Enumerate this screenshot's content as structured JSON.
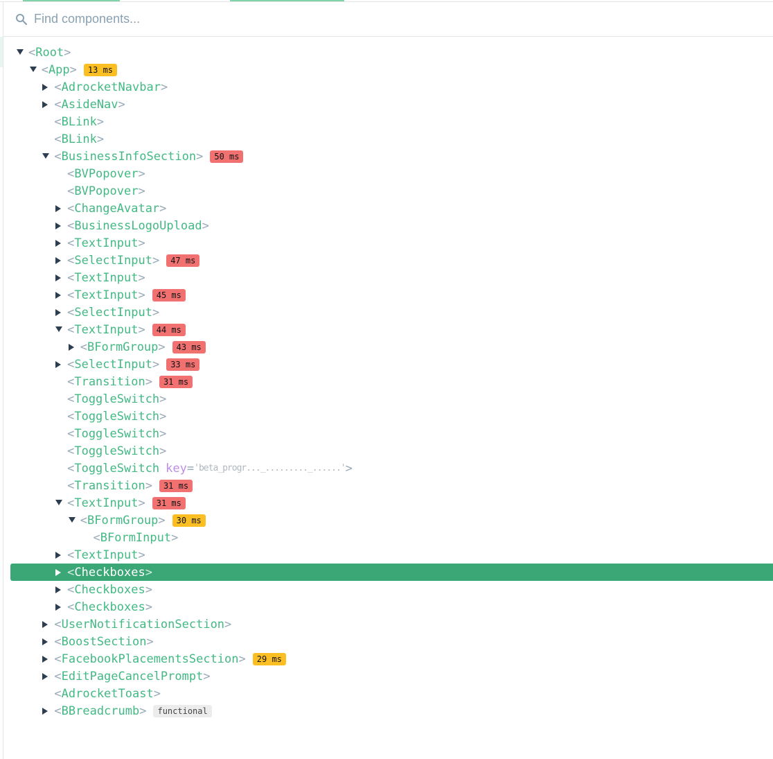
{
  "search": {
    "placeholder": "Find components...",
    "value": "",
    "icon": "search-icon"
  },
  "colors": {
    "accent": "#42b983",
    "selected_bg": "#3ba776",
    "badge_warn": "#fbbf24",
    "badge_slow": "#f17171",
    "badge_functional": "#ececec",
    "attr_key": "#c08be6",
    "bracket": "#97a8b6"
  },
  "tree": [
    {
      "depth": 0,
      "name": "Root",
      "arrow": "expanded"
    },
    {
      "depth": 1,
      "name": "App",
      "arrow": "expanded",
      "badge": "13 ms",
      "badge_type": "warn"
    },
    {
      "depth": 2,
      "name": "AdrocketNavbar",
      "arrow": "collapsed"
    },
    {
      "depth": 2,
      "name": "AsideNav",
      "arrow": "collapsed"
    },
    {
      "depth": 2,
      "name": "BLink",
      "arrow": "none"
    },
    {
      "depth": 2,
      "name": "BLink",
      "arrow": "none"
    },
    {
      "depth": 2,
      "name": "BusinessInfoSection",
      "arrow": "expanded",
      "badge": "50 ms",
      "badge_type": "slow"
    },
    {
      "depth": 3,
      "name": "BVPopover",
      "arrow": "none"
    },
    {
      "depth": 3,
      "name": "BVPopover",
      "arrow": "none"
    },
    {
      "depth": 3,
      "name": "ChangeAvatar",
      "arrow": "collapsed"
    },
    {
      "depth": 3,
      "name": "BusinessLogoUpload",
      "arrow": "collapsed"
    },
    {
      "depth": 3,
      "name": "TextInput",
      "arrow": "collapsed"
    },
    {
      "depth": 3,
      "name": "SelectInput",
      "arrow": "collapsed",
      "badge": "47 ms",
      "badge_type": "slow"
    },
    {
      "depth": 3,
      "name": "TextInput",
      "arrow": "collapsed"
    },
    {
      "depth": 3,
      "name": "TextInput",
      "arrow": "collapsed",
      "badge": "45 ms",
      "badge_type": "slow"
    },
    {
      "depth": 3,
      "name": "SelectInput",
      "arrow": "collapsed"
    },
    {
      "depth": 3,
      "name": "TextInput",
      "arrow": "expanded",
      "badge": "44 ms",
      "badge_type": "slow"
    },
    {
      "depth": 4,
      "name": "BFormGroup",
      "arrow": "collapsed",
      "badge": "43 ms",
      "badge_type": "slow"
    },
    {
      "depth": 3,
      "name": "SelectInput",
      "arrow": "collapsed",
      "badge": "33 ms",
      "badge_type": "slow"
    },
    {
      "depth": 3,
      "name": "Transition",
      "arrow": "none",
      "badge": "31 ms",
      "badge_type": "slow"
    },
    {
      "depth": 3,
      "name": "ToggleSwitch",
      "arrow": "none"
    },
    {
      "depth": 3,
      "name": "ToggleSwitch",
      "arrow": "none"
    },
    {
      "depth": 3,
      "name": "ToggleSwitch",
      "arrow": "none"
    },
    {
      "depth": 3,
      "name": "ToggleSwitch",
      "arrow": "none"
    },
    {
      "depth": 3,
      "name": "ToggleSwitch",
      "arrow": "none",
      "attr_key": "key",
      "attr_val": "'beta_progr..._........._......'"
    },
    {
      "depth": 3,
      "name": "Transition",
      "arrow": "none",
      "badge": "31 ms",
      "badge_type": "slow"
    },
    {
      "depth": 3,
      "name": "TextInput",
      "arrow": "expanded",
      "badge": "31 ms",
      "badge_type": "slow"
    },
    {
      "depth": 4,
      "name": "BFormGroup",
      "arrow": "expanded",
      "badge": "30 ms",
      "badge_type": "warn"
    },
    {
      "depth": 5,
      "name": "BFormInput",
      "arrow": "none"
    },
    {
      "depth": 3,
      "name": "TextInput",
      "arrow": "collapsed"
    },
    {
      "depth": 3,
      "name": "Checkboxes",
      "arrow": "collapsed",
      "selected": true
    },
    {
      "depth": 3,
      "name": "Checkboxes",
      "arrow": "collapsed"
    },
    {
      "depth": 3,
      "name": "Checkboxes",
      "arrow": "collapsed"
    },
    {
      "depth": 2,
      "name": "UserNotificationSection",
      "arrow": "collapsed"
    },
    {
      "depth": 2,
      "name": "BoostSection",
      "arrow": "collapsed"
    },
    {
      "depth": 2,
      "name": "FacebookPlacementsSection",
      "arrow": "collapsed",
      "badge": "29 ms",
      "badge_type": "warn"
    },
    {
      "depth": 2,
      "name": "EditPageCancelPrompt",
      "arrow": "collapsed"
    },
    {
      "depth": 2,
      "name": "AdrocketToast",
      "arrow": "none"
    },
    {
      "depth": 2,
      "name": "BBreadcrumb",
      "arrow": "collapsed",
      "badge": "functional",
      "badge_type": "func"
    }
  ]
}
